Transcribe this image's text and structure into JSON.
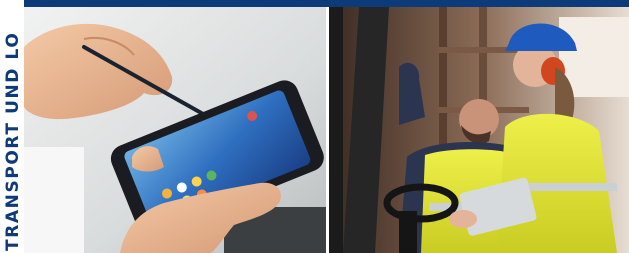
{
  "side_label": {
    "text": "TRANSPORT UND LO"
  },
  "colors": {
    "brand_blue": "#0d3a78",
    "safety_yellow": "#e6e830",
    "helmet_blue": "#1f5bbf"
  },
  "photos": [
    {
      "name": "photo-smartphone-stylus"
    },
    {
      "name": "photo-warehouse-forklift-workers"
    }
  ]
}
